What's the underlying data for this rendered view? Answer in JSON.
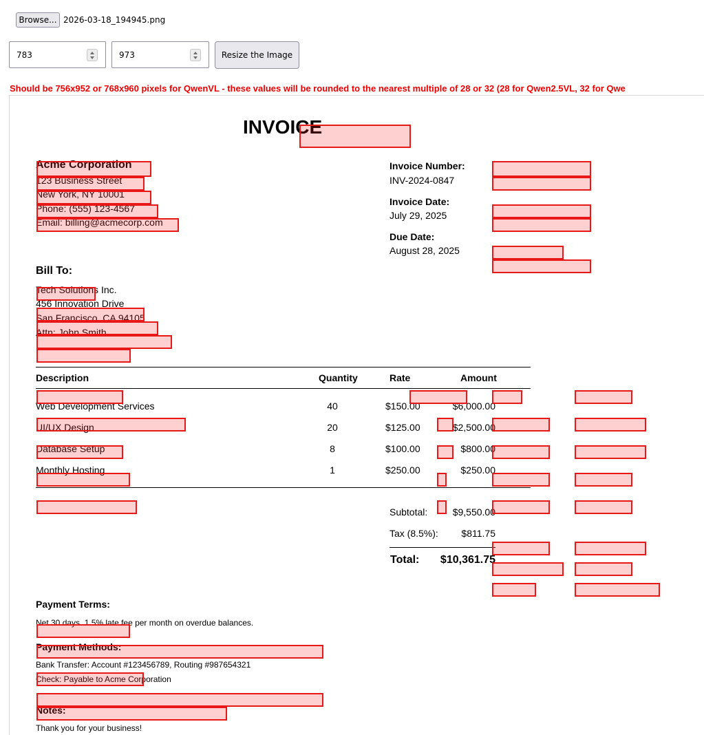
{
  "controls": {
    "browse_label": "Browse...",
    "file_name": "2026-03-18_194945.png",
    "width_value": "783",
    "height_value": "973",
    "resize_label": "Resize the Image",
    "warning": "Should be 756x952 or 768x960 pixels for QwenVL - these values will be rounded to the nearest multiple of 28 or 32 (28 for Qwen2.5VL, 32 for Qwe"
  },
  "invoice": {
    "title": "INVOICE",
    "company": {
      "name": "Acme Corporation",
      "street": "123 Business Street",
      "city": "New York, NY 10001",
      "phone": "Phone: (555) 123-4567",
      "email": "Email: billing@acmecorp.com"
    },
    "meta": {
      "number_label": "Invoice Number:",
      "number_value": "INV-2024-0847",
      "date_label": "Invoice Date:",
      "date_value": "July 29, 2025",
      "due_label": "Due Date:",
      "due_value": "August 28, 2025"
    },
    "bill_to": {
      "heading": "Bill To:",
      "name": "Tech Solutions Inc.",
      "street": "456 Innovation Drive",
      "city": "San Francisco, CA 94105",
      "attn": "Attn: John Smith"
    },
    "table": {
      "headers": [
        "Description",
        "Quantity",
        "Rate",
        "Amount"
      ],
      "rows": [
        {
          "description": "Web Development Services",
          "quantity": "40",
          "rate": "$150.00",
          "amount": "$6,000.00"
        },
        {
          "description": "UI/UX Design",
          "quantity": "20",
          "rate": "$125.00",
          "amount": "$2,500.00"
        },
        {
          "description": "Database Setup",
          "quantity": "8",
          "rate": "$100.00",
          "amount": "$800.00"
        },
        {
          "description": "Monthly Hosting",
          "quantity": "1",
          "rate": "$250.00",
          "amount": "$250.00"
        }
      ]
    },
    "totals": {
      "subtotal_label": "Subtotal:",
      "subtotal_value": "$9,550.00",
      "tax_label": "Tax (8.5%):",
      "tax_value": "$811.75",
      "total_label": "Total:",
      "total_value": "$10,361.75"
    },
    "payment_terms": {
      "heading": "Payment Terms:",
      "text": "Net 30 days. 1.5% late fee per month on overdue balances."
    },
    "payment_methods": {
      "heading": "Payment Methods:",
      "bank": "Bank Transfer: Account #123456789, Routing #987654321",
      "check": "Check: Payable to Acme Corporation"
    },
    "notes": {
      "heading": "Notes:",
      "text": "Thank you for your business!"
    }
  },
  "overlay_color": "#e81818"
}
